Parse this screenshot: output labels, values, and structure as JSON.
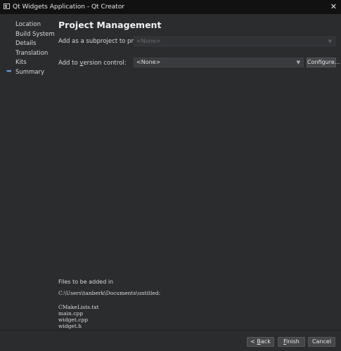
{
  "window": {
    "title": "Qt Widgets Application - Qt Creator",
    "close_glyph": "✕"
  },
  "sidebar": {
    "items": [
      {
        "label": "Location",
        "current": false
      },
      {
        "label": "Build System",
        "current": false
      },
      {
        "label": "Details",
        "current": false
      },
      {
        "label": "Translation",
        "current": false
      },
      {
        "label": "Kits",
        "current": false
      },
      {
        "label": "Summary",
        "current": true
      }
    ],
    "current_icon": "arrow-right-icon"
  },
  "main": {
    "title": "Project Management",
    "subproject_label": "Add as a subproject to project:",
    "subproject_value": "<None>",
    "vcs_label": "Add to version control:",
    "vcs_value": "<None>",
    "configure_label": "Configure...",
    "files_heading": "Files to be added in",
    "files_path": "C:\\Users\\tanberk\\Documents\\untitled:",
    "files": [
      "CMakeLists.txt",
      "main.cpp",
      "widget.cpp",
      "widget.h"
    ]
  },
  "footer": {
    "back_label": "< Back",
    "finish_label": "Finish",
    "cancel_label": "Cancel"
  },
  "colors": {
    "background": "#2b2c2e",
    "titlebar": "#111111",
    "accent_arrow": "#6aa0e0"
  }
}
